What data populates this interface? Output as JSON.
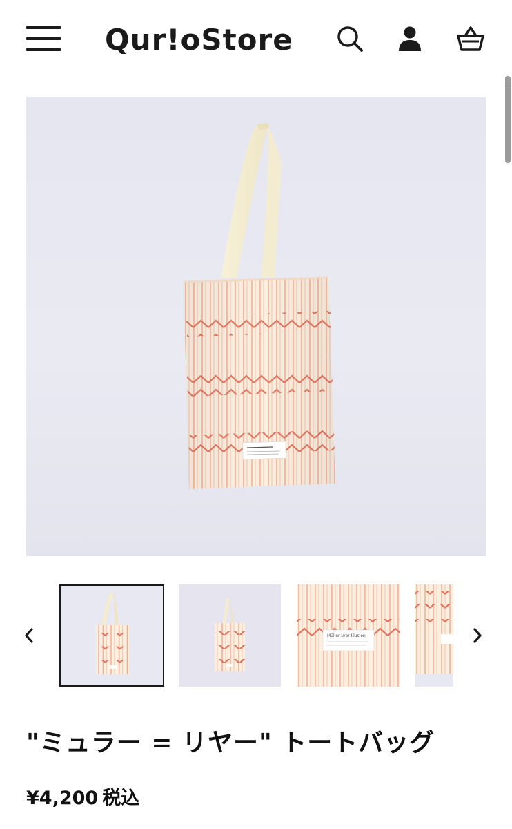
{
  "header": {
    "logo": "Qur!oStore",
    "icons": [
      "hamburger-menu-icon",
      "search-icon",
      "user-icon",
      "cart-icon"
    ]
  },
  "gallery": {
    "label_text": [
      "Müller-Lyer Illusion"
    ],
    "thumbnails_count": 4,
    "selected_thumbnail": 1
  },
  "product": {
    "title": "\"ミュラー = リヤー\" トートバッグ",
    "price": "¥4,200",
    "tax_label": "税込"
  },
  "colors": {
    "background": "#ffffff",
    "text": "#1a1a1a",
    "bag_fabric": "#fbeee0",
    "stripe": "#e8a08a",
    "zigzag": "#e2735f",
    "photo_backdrop": "#e8e8f2"
  }
}
